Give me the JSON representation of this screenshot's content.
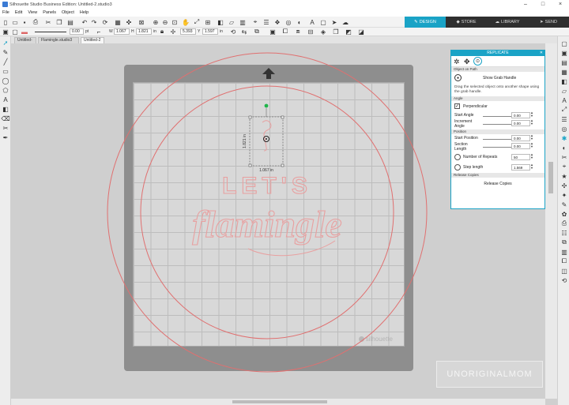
{
  "window": {
    "title": "Silhouette Studio Business Edition: Untitled-2.studio3",
    "minimize": "–",
    "maximize": "□",
    "close": "×"
  },
  "menu": [
    "File",
    "Edit",
    "View",
    "Panels",
    "Object",
    "Help"
  ],
  "nav_tabs": [
    {
      "label": "DESIGN",
      "icon": "pen-icon",
      "active": true
    },
    {
      "label": "STORE",
      "icon": "tag-icon",
      "active": false
    },
    {
      "label": "LIBRARY",
      "icon": "cloud-icon",
      "active": false
    },
    {
      "label": "SEND",
      "icon": "send-icon",
      "active": false
    }
  ],
  "toolbar2": {
    "line_width": "0.00",
    "line_unit": "pt",
    "w_label": "W",
    "w_value": "1.067",
    "h_label": "H",
    "h_value": "1.821",
    "h_unit": "in",
    "x_value": "5.393",
    "y_label": "Y",
    "y_value": "1.597",
    "xy_unit": "in"
  },
  "doc_tabs": [
    {
      "label": "Untitled-1",
      "active": false
    },
    {
      "label": "Flamingle.studio3",
      "active": false
    },
    {
      "label": "Untitled-2",
      "active": true
    }
  ],
  "canvas": {
    "design_line1": "LET'S",
    "design_line2": "flamingle",
    "brand": "silhouette",
    "selection_width": "1.067 in",
    "selection_height": "1.821 in",
    "colors": {
      "design": "#e8a0a0",
      "circle": "#e07070",
      "accent": "#1aa3c6"
    }
  },
  "replicate_panel": {
    "title": "REPLICATE",
    "section_object_on_path": "Object on Path",
    "show_grab_handle": "Show Grab Handle",
    "description": "Drag the selected object onto another shape using the grab handle.",
    "section_angle": "Angle",
    "perpendicular": "Perpendicular",
    "start_angle_label": "Start Angle",
    "start_angle_value": "0.00",
    "increment_angle_label1": "Increment",
    "increment_angle_label2": "Angle",
    "increment_angle_value": "0.00",
    "section_position": "Position",
    "start_position_label": "Start Position",
    "start_position_value": "0.00",
    "section_length_label1": "Section",
    "section_length_label2": "Length",
    "section_length_value": "0.00",
    "number_of_repeats_label": "Number of Repeats",
    "number_of_repeats_value": "50",
    "step_length_label": "Step length",
    "step_length_value": "1.569",
    "section_release": "Release Copies",
    "release_button": "Release Copies"
  },
  "watermark": "UNORIGINALMOM"
}
